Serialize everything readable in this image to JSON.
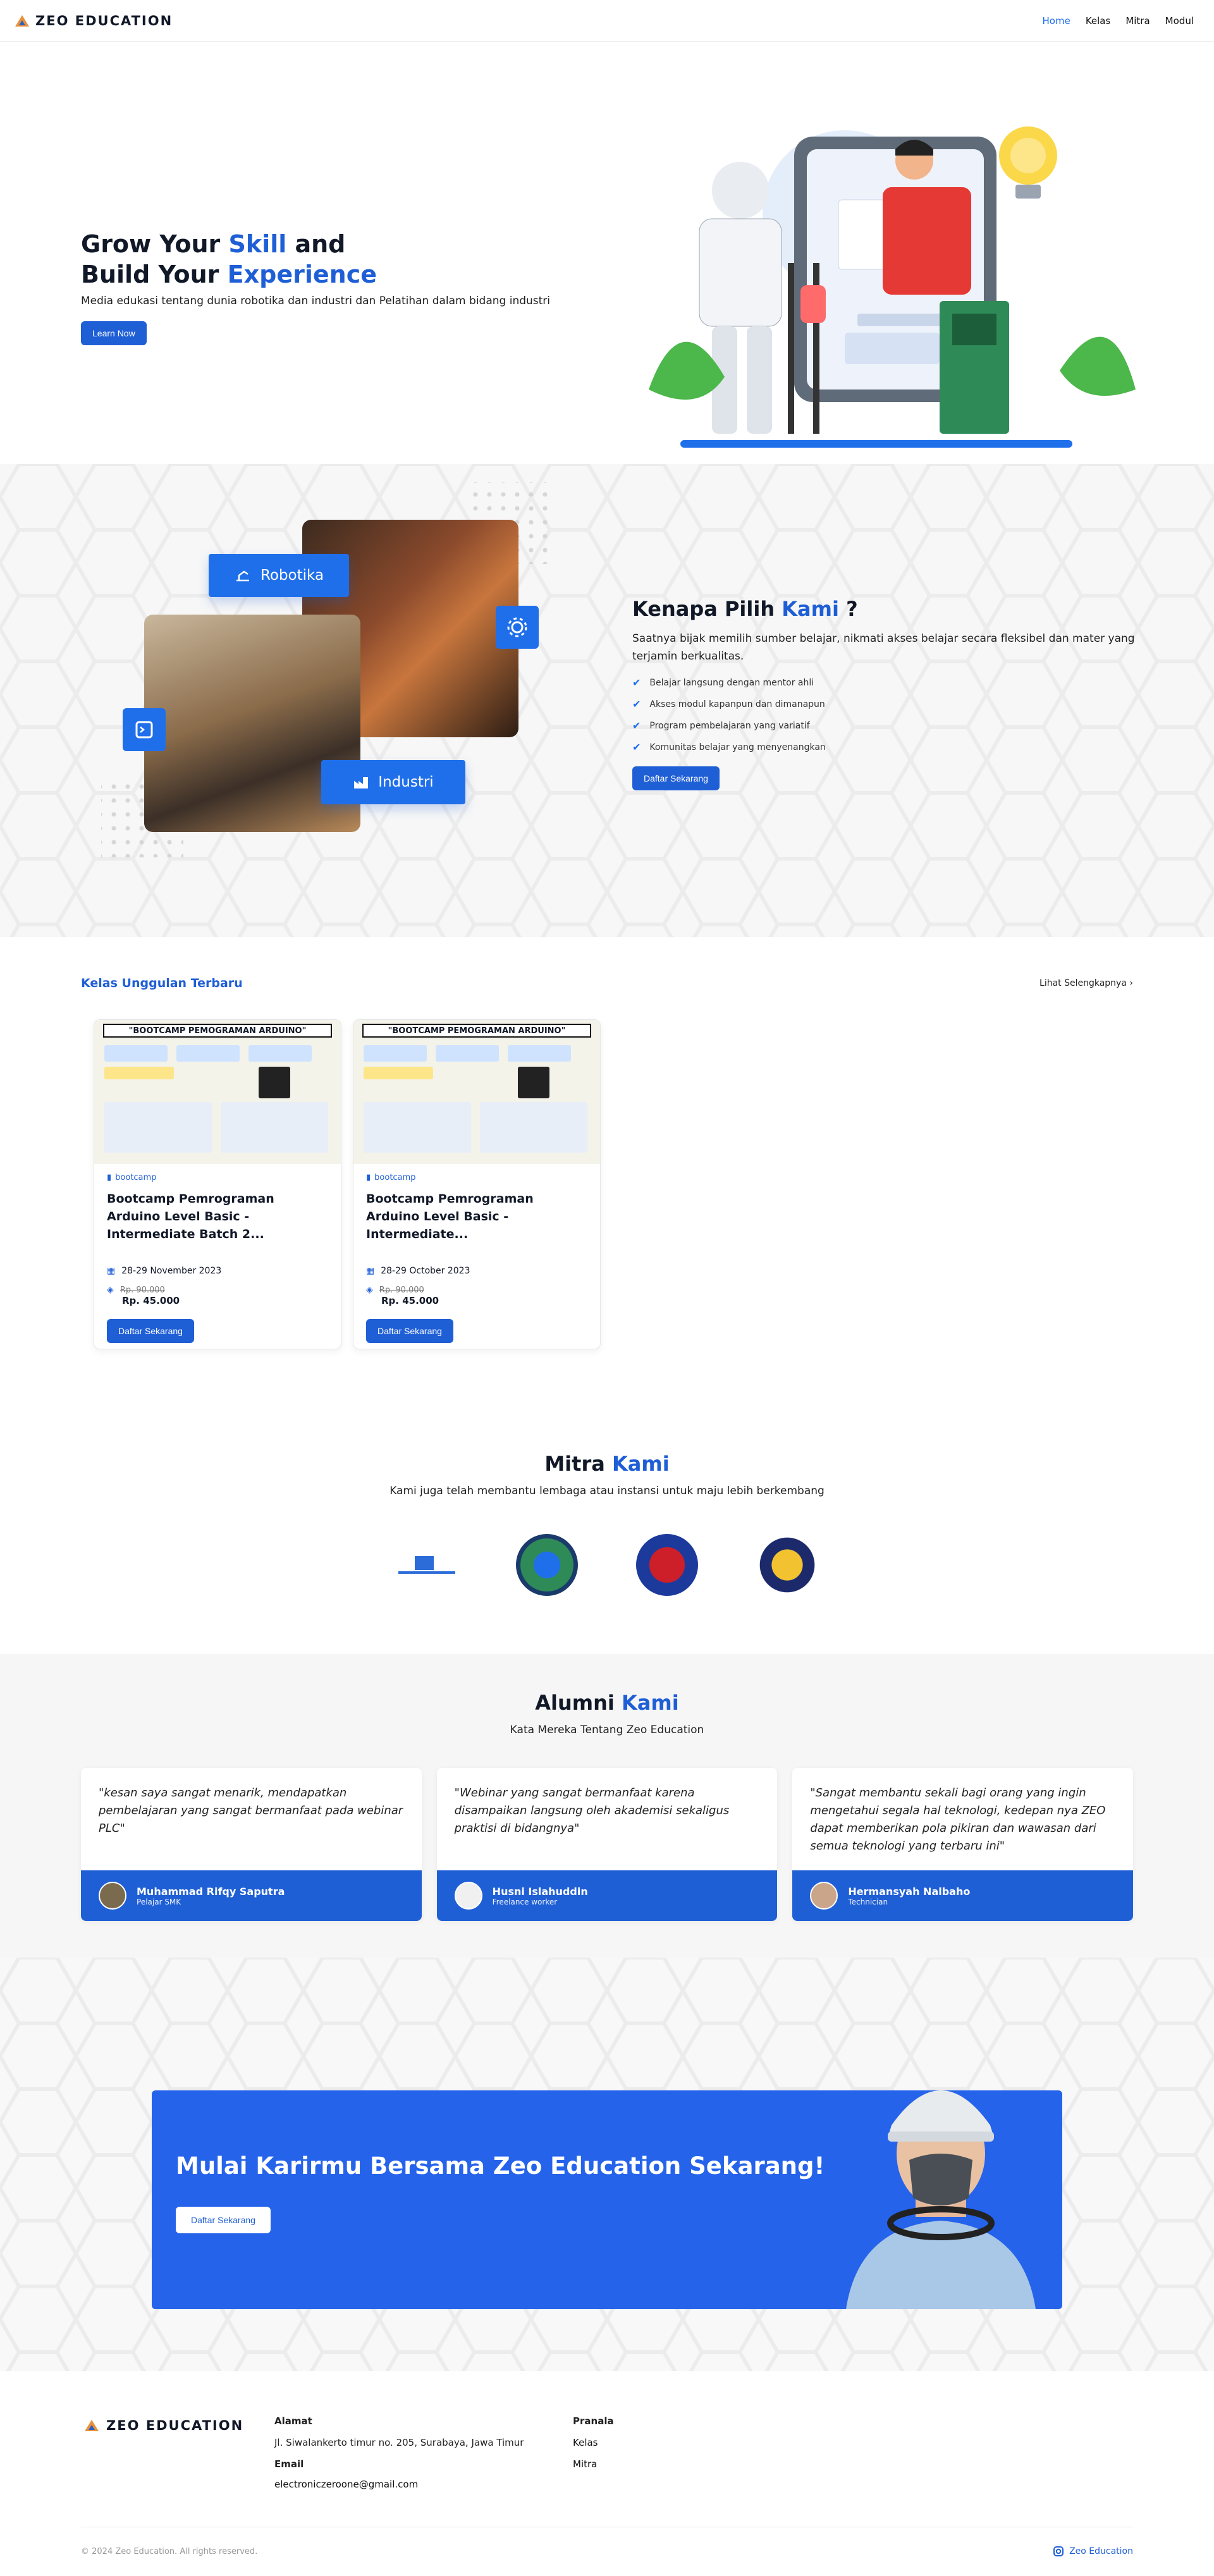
{
  "nav": {
    "brand": "ZEO EDUCATION",
    "links": [
      "Home",
      "Kelas",
      "Mitra",
      "Modul"
    ],
    "active": "Home"
  },
  "hero": {
    "title_1a": "Grow Your ",
    "title_1b": "Skill",
    "title_1c": " and",
    "title_2a": "Build Your ",
    "title_2b": "Experience",
    "subtitle": "Media edukasi tentang dunia robotika dan industri dan Pelatihan dalam bidang industri",
    "cta": "Learn Now"
  },
  "why": {
    "chip_robotika": "Robotika",
    "chip_industri": "Industri",
    "title_a": "Kenapa Pilih ",
    "title_b": "Kami",
    "title_c": " ?",
    "desc": "Saatnya bijak memilih sumber belajar, nikmati akses belajar secara fleksibel dan mater yang terjamin berkualitas.",
    "points": [
      "Belajar langsung dengan mentor ahli",
      "Akses modul kapanpun dan dimanapun",
      "Program pembelajaran yang variatif",
      "Komunitas belajar yang menyenangkan"
    ],
    "cta": "Daftar Sekarang"
  },
  "courses": {
    "title": "Kelas Unggulan Terbaru",
    "see_more": "Lihat Selengkapnya",
    "items": [
      {
        "poster_title": "\"BOOTCAMP PEMOGRAMAN ARDUINO\"",
        "tag": "bootcamp",
        "title": "Bootcamp Pemrograman Arduino Level Basic - Intermediate Batch 2...",
        "date": "28-29 November 2023",
        "price_old": "Rp. 90.000",
        "price_new": "Rp. 45.000",
        "cta": "Daftar Sekarang"
      },
      {
        "poster_title": "\"BOOTCAMP PEMOGRAMAN ARDUINO\"",
        "tag": "bootcamp",
        "title": "Bootcamp Pemrograman Arduino Level Basic - Intermediate...",
        "date": "28-29 October 2023",
        "price_old": "Rp. 90.000",
        "price_new": "Rp. 45.000",
        "cta": "Daftar Sekarang"
      }
    ]
  },
  "partners": {
    "title_a": "Mitra ",
    "title_b": "Kami",
    "subtitle": "Kami juga telah membantu lembaga atau instansi untuk maju lebih berkembang"
  },
  "testimonials": {
    "title_a": "Alumni ",
    "title_b": "Kami",
    "subtitle": "Kata Mereka Tentang Zeo Education",
    "items": [
      {
        "quote": "\"kesan saya sangat menarik, mendapatkan pembelajaran yang sangat bermanfaat pada webinar PLC\"",
        "name": "Muhammad Rifqy Saputra",
        "role": "Pelajar SMK"
      },
      {
        "quote": "\"Webinar yang sangat bermanfaat karena disampaikan langsung oleh akademisi sekaligus praktisi di bidangnya\"",
        "name": "Husni Islahuddin",
        "role": "Freelance worker"
      },
      {
        "quote": "\"Sangat membantu sekali bagi orang yang ingin mengetahui segala hal teknologi, kedepan nya ZEO dapat memberikan pola pikiran dan wawasan dari semua teknologi yang terbaru ini\"",
        "name": "Hermansyah Nalbaho",
        "role": "Technician"
      }
    ]
  },
  "cta": {
    "title": "Mulai Karirmu Bersama Zeo Education Sekarang!",
    "button": "Daftar Sekarang"
  },
  "footer": {
    "brand": "ZEO EDUCATION",
    "alamat_label": "Alamat",
    "alamat": "Jl. Siwalankerto timur no. 205, Surabaya, Jawa Timur",
    "email_label": "Email",
    "email": "electroniczeroone@gmail.com",
    "pranala_label": "Pranala",
    "pranala": [
      "Kelas",
      "Mitra"
    ],
    "copyright": "© 2024 Zeo Education. All rights reserved.",
    "instagram": "Zeo Education"
  },
  "colors": {
    "brand_blue": "#1f5fd6",
    "accent_blue": "#2563eb"
  }
}
